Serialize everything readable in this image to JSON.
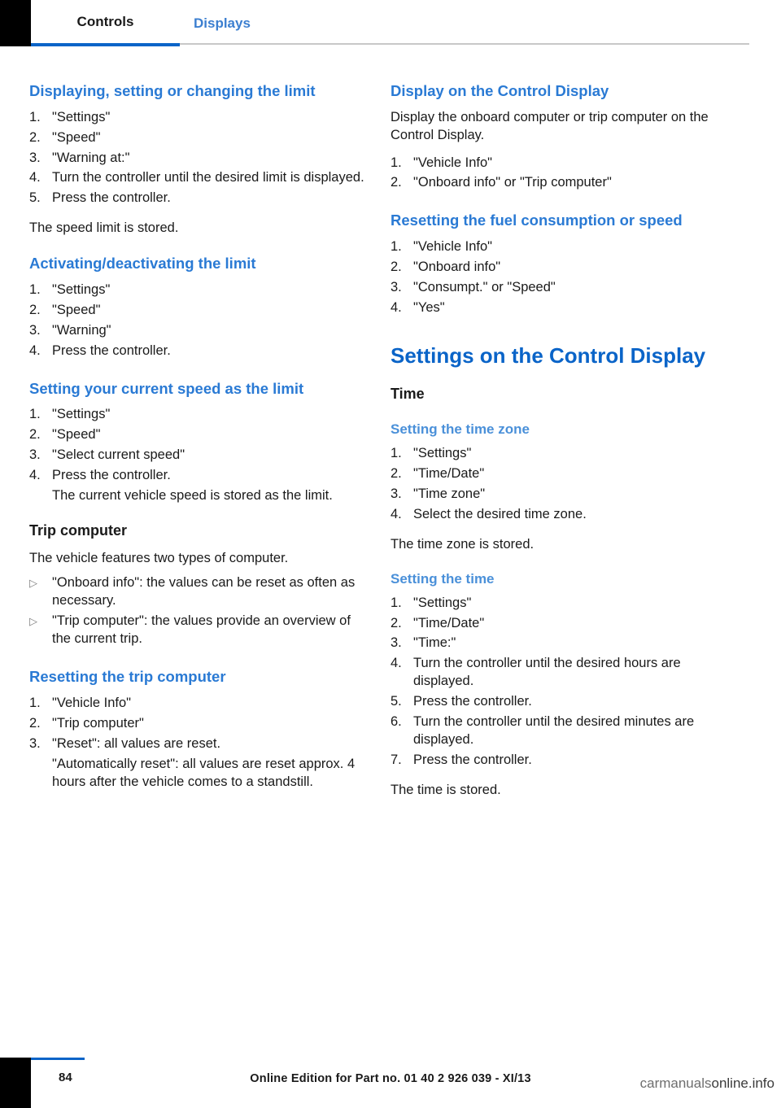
{
  "header": {
    "tab_active": "Controls",
    "tab_inactive": "Displays"
  },
  "left_column": {
    "s1_title": "Displaying, setting or changing the limit",
    "s1_steps": [
      {
        "marker": "1.",
        "text": "\"Settings\""
      },
      {
        "marker": "2.",
        "text": "\"Speed\""
      },
      {
        "marker": "3.",
        "text": "\"Warning at:\""
      },
      {
        "marker": "4.",
        "text": "Turn the controller until the desired limit is displayed."
      },
      {
        "marker": "5.",
        "text": "Press the controller."
      }
    ],
    "s1_after": "The speed limit is stored.",
    "s2_title": "Activating/deactivating the limit",
    "s2_steps": [
      {
        "marker": "1.",
        "text": "\"Settings\""
      },
      {
        "marker": "2.",
        "text": "\"Speed\""
      },
      {
        "marker": "3.",
        "text": "\"Warning\""
      },
      {
        "marker": "4.",
        "text": "Press the controller."
      }
    ],
    "s3_title": "Setting your current speed as the limit",
    "s3_steps": [
      {
        "marker": "1.",
        "text": "\"Settings\""
      },
      {
        "marker": "2.",
        "text": "\"Speed\""
      },
      {
        "marker": "3.",
        "text": "\"Select current speed\""
      },
      {
        "marker": "4.",
        "text": "Press the controller."
      }
    ],
    "s3_indent": "The current vehicle speed is stored as the limit.",
    "s4_title": "Trip computer",
    "s4_para": "The vehicle features two types of computer.",
    "s4_bullets": [
      {
        "marker": "▷",
        "text": "\"Onboard info\": the values can be reset as often as necessary."
      },
      {
        "marker": "▷",
        "text": "\"Trip computer\": the values provide an overview of the current trip."
      }
    ],
    "s5_title": "Resetting the trip computer",
    "s5_steps": [
      {
        "marker": "1.",
        "text": "\"Vehicle Info\""
      },
      {
        "marker": "2.",
        "text": "\"Trip computer\""
      },
      {
        "marker": "3.",
        "text": "\"Reset\": all values are reset."
      }
    ],
    "s5_indent": "\"Automatically reset\": all values are reset approx. 4 hours after the vehicle comes to a standstill."
  },
  "right_column": {
    "s1_title": "Display on the Control Display",
    "s1_para": "Display the onboard computer or trip computer on the Control Display.",
    "s1_steps": [
      {
        "marker": "1.",
        "text": "\"Vehicle Info\""
      },
      {
        "marker": "2.",
        "text": "\"Onboard info\" or \"Trip computer\""
      }
    ],
    "s2_title": "Resetting the fuel consumption or speed",
    "s2_steps": [
      {
        "marker": "1.",
        "text": "\"Vehicle Info\""
      },
      {
        "marker": "2.",
        "text": "\"Onboard info\""
      },
      {
        "marker": "3.",
        "text": "\"Consumpt.\" or \"Speed\""
      },
      {
        "marker": "4.",
        "text": "\"Yes\""
      }
    ],
    "chapter_title": "Settings on the Control Display",
    "sub_title": "Time",
    "s3_title": "Setting the time zone",
    "s3_steps": [
      {
        "marker": "1.",
        "text": "\"Settings\""
      },
      {
        "marker": "2.",
        "text": "\"Time/Date\""
      },
      {
        "marker": "3.",
        "text": "\"Time zone\""
      },
      {
        "marker": "4.",
        "text": "Select the desired time zone."
      }
    ],
    "s3_after": "The time zone is stored.",
    "s4_title": "Setting the time",
    "s4_steps": [
      {
        "marker": "1.",
        "text": "\"Settings\""
      },
      {
        "marker": "2.",
        "text": "\"Time/Date\""
      },
      {
        "marker": "3.",
        "text": "\"Time:\""
      },
      {
        "marker": "4.",
        "text": "Turn the controller until the desired hours are displayed."
      },
      {
        "marker": "5.",
        "text": "Press the controller."
      },
      {
        "marker": "6.",
        "text": "Turn the controller until the desired minutes are displayed."
      },
      {
        "marker": "7.",
        "text": "Press the controller."
      }
    ],
    "s4_after": "The time is stored."
  },
  "footer": {
    "page_number": "84",
    "online_edition": "Online Edition for Part no. 01 40 2 926 039 - XI/13",
    "watermark_light": "carmanuals",
    "watermark_dark": "online.info"
  }
}
